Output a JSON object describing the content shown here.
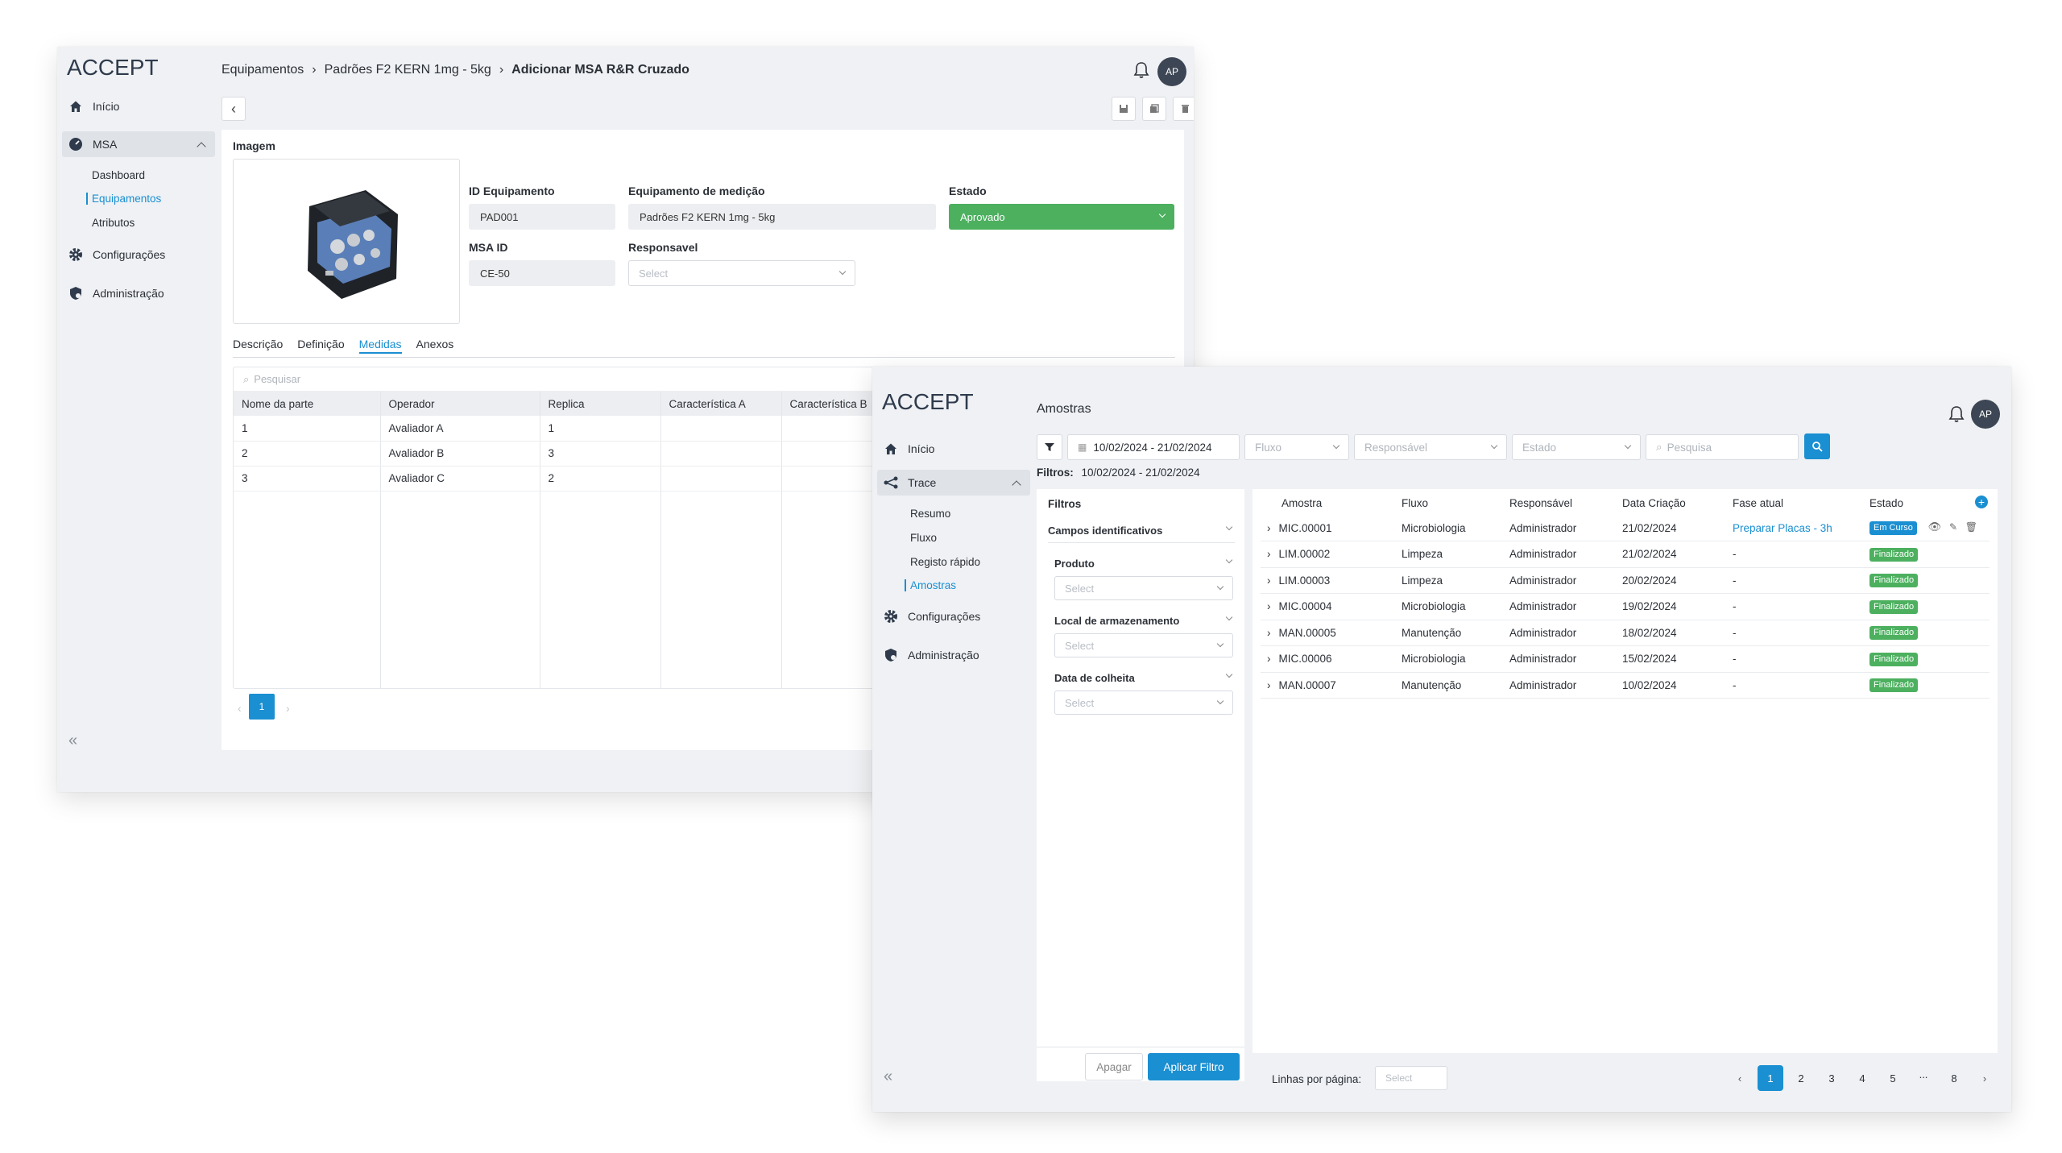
{
  "winA": {
    "brand": "ACCEPT",
    "breadcrumb": [
      "Equipamentos",
      "Padrões F2 KERN 1mg - 5kg",
      "Adicionar MSA R&R Cruzado"
    ],
    "avatar": "AP",
    "nav": {
      "inicio": "Início",
      "msa": "MSA",
      "msa_sub": [
        "Dashboard",
        "Equipamentos",
        "Atributos"
      ],
      "config": "Configurações",
      "admin": "Administração"
    },
    "form": {
      "image_label": "Imagem",
      "id_equip_label": "ID Equipamento",
      "id_equip_value": "PAD001",
      "equip_medicao_label": "Equipamento de medição",
      "equip_medicao_value": "Padrões F2 KERN 1mg - 5kg",
      "estado_label": "Estado",
      "estado_value": "Aprovado",
      "msa_id_label": "MSA ID",
      "msa_id_value": "CE-50",
      "responsavel_label": "Responsavel",
      "responsavel_placeholder": "Select"
    },
    "tabs": [
      "Descrição",
      "Definição",
      "Medidas",
      "Anexos"
    ],
    "search_placeholder": "Pesquisar",
    "table": {
      "headers": [
        "Nome da parte",
        "Operador",
        "Replica",
        "Característica A",
        "Característica B"
      ],
      "rows": [
        [
          "1",
          "Avaliador A",
          "1",
          "",
          ""
        ],
        [
          "2",
          "Avaliador B",
          "3",
          "",
          ""
        ],
        [
          "3",
          "Avaliador C",
          "2",
          "",
          ""
        ]
      ]
    },
    "page": "1",
    "colors": {
      "accent": "#1a8fd1",
      "status_green": "#4cb05f"
    }
  },
  "winB": {
    "brand": "ACCEPT",
    "title": "Amostras",
    "avatar": "AP",
    "nav": {
      "inicio": "Início",
      "trace": "Trace",
      "trace_sub": [
        "Resumo",
        "Fluxo",
        "Registo rápido",
        "Amostras"
      ],
      "config": "Configurações",
      "admin": "Administração"
    },
    "filterbar": {
      "date_range": "10/02/2024 - 21/02/2024",
      "fluxo": "Fluxo",
      "responsavel": "Responsável",
      "estado": "Estado",
      "search_placeholder": "Pesquisa"
    },
    "filters_summary_label": "Filtros:",
    "filters_summary_value": "10/02/2024 - 21/02/2024",
    "filter_panel": {
      "title": "Filtros",
      "group": "Campos identificativos",
      "produto": "Produto",
      "local": "Local de armazenamento",
      "data_colheita": "Data de colheita",
      "select_placeholder": "Select",
      "clear": "Apagar",
      "apply": "Aplicar Filtro"
    },
    "table": {
      "headers": [
        "Amostra",
        "Fluxo",
        "Responsável",
        "Data Criação",
        "Fase atual",
        "Estado"
      ],
      "rows": [
        {
          "amostra": "MIC.00001",
          "fluxo": "Microbiologia",
          "resp": "Administrador",
          "data": "21/02/2024",
          "fase": "Preparar Placas - 3h",
          "estado": "Em Curso"
        },
        {
          "amostra": "LIM.00002",
          "fluxo": "Limpeza",
          "resp": "Administrador",
          "data": "21/02/2024",
          "fase": "-",
          "estado": "Finalizado"
        },
        {
          "amostra": "LIM.00003",
          "fluxo": "Limpeza",
          "resp": "Administrador",
          "data": "20/02/2024",
          "fase": "-",
          "estado": "Finalizado"
        },
        {
          "amostra": "MIC.00004",
          "fluxo": "Microbiologia",
          "resp": "Administrador",
          "data": "19/02/2024",
          "fase": "-",
          "estado": "Finalizado"
        },
        {
          "amostra": "MAN.00005",
          "fluxo": "Manutenção",
          "resp": "Administrador",
          "data": "18/02/2024",
          "fase": "-",
          "estado": "Finalizado"
        },
        {
          "amostra": "MIC.00006",
          "fluxo": "Microbiologia",
          "resp": "Administrador",
          "data": "15/02/2024",
          "fase": "-",
          "estado": "Finalizado"
        },
        {
          "amostra": "MAN.00007",
          "fluxo": "Manutenção",
          "resp": "Administrador",
          "data": "10/02/2024",
          "fase": "-",
          "estado": "Finalizado"
        }
      ]
    },
    "rows_per_page_label": "Linhas por página:",
    "rows_per_page_placeholder": "Select",
    "pagination": [
      "1",
      "2",
      "3",
      "4",
      "5",
      "...",
      "8"
    ]
  }
}
